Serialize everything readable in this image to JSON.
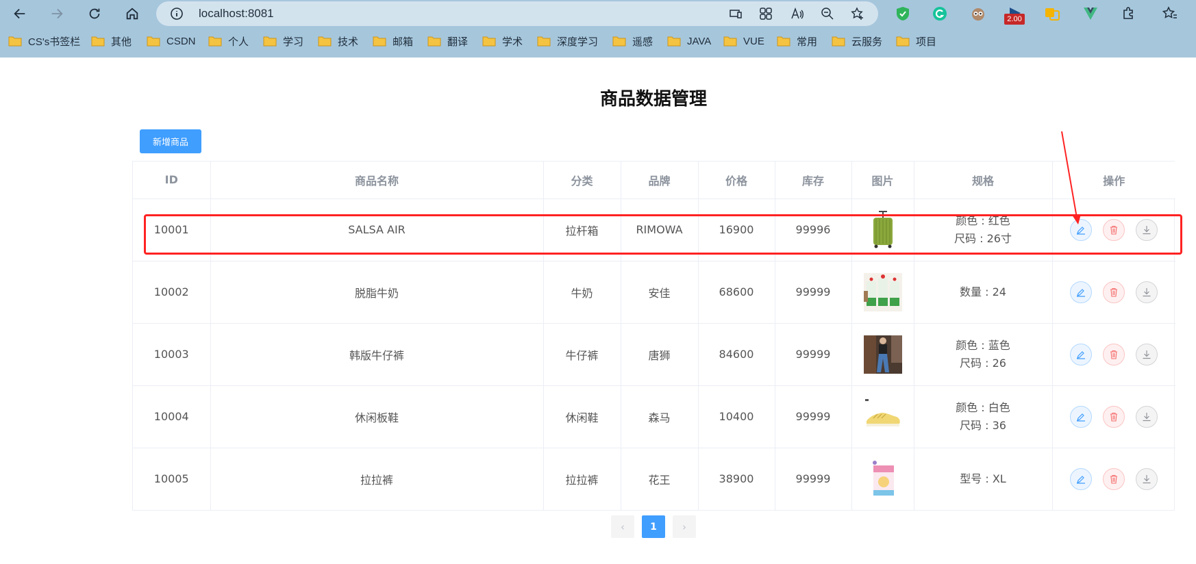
{
  "browser": {
    "url": "localhost:8081",
    "extension_badge": "2.00",
    "bookmarks": [
      "CS's书签栏",
      "其他",
      "CSDN",
      "个人",
      "学习",
      "技术",
      "邮箱",
      "翻译",
      "学术",
      "深度学习",
      "遥感",
      "JAVA",
      "VUE",
      "常用",
      "云服务",
      "项目"
    ]
  },
  "page": {
    "title": "商品数据管理",
    "add_button": "新增商品"
  },
  "table": {
    "headers": [
      "ID",
      "商品名称",
      "分类",
      "品牌",
      "价格",
      "库存",
      "图片",
      "规格",
      "操作"
    ],
    "rows": [
      {
        "id": "10001",
        "name": "SALSA AIR",
        "category": "拉杆箱",
        "brand": "RIMOWA",
        "price": "16900",
        "stock": "99996",
        "image": "green-suitcase",
        "spec": [
          "颜色 : 红色",
          "尺码 : 26寸"
        ]
      },
      {
        "id": "10002",
        "name": "脱脂牛奶",
        "category": "牛奶",
        "brand": "安佳",
        "price": "68600",
        "stock": "99999",
        "image": "milk-cartons",
        "spec": [
          "数量 : 24"
        ]
      },
      {
        "id": "10003",
        "name": "韩版牛仔裤",
        "category": "牛仔裤",
        "brand": "唐狮",
        "price": "84600",
        "stock": "99999",
        "image": "jeans-model",
        "spec": [
          "颜色 : 蓝色",
          "尺码 : 26"
        ]
      },
      {
        "id": "10004",
        "name": "休闲板鞋",
        "category": "休闲鞋",
        "brand": "森马",
        "price": "10400",
        "stock": "99999",
        "image": "yellow-sneakers",
        "spec": [
          "颜色 : 白色",
          "尺码 : 36"
        ]
      },
      {
        "id": "10005",
        "name": "拉拉裤",
        "category": "拉拉裤",
        "brand": "花王",
        "price": "38900",
        "stock": "99999",
        "image": "diaper-pack",
        "spec": [
          "型号 : XL"
        ]
      }
    ]
  },
  "pagination": {
    "prev": "‹",
    "current": "1",
    "next": "›"
  },
  "colors": {
    "primary": "#409eff",
    "danger": "#f56c6c",
    "annotation": "#ff2222",
    "chrome": "#a6c6dc"
  }
}
